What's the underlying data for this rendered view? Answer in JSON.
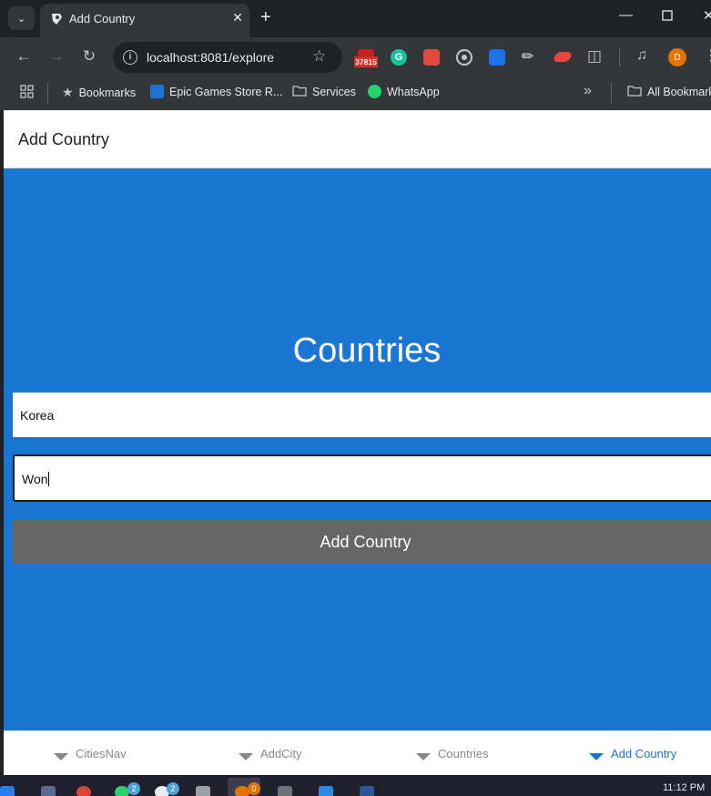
{
  "browser": {
    "tab": {
      "title": "Add Country"
    },
    "address_bar": {
      "url": "localhost:8081/explore"
    },
    "extension_badge": "37815",
    "profile_initial": "D",
    "bookmarks": {
      "bookmarks_label": "Bookmarks",
      "items": [
        "Epic Games Store R...",
        "Services",
        "WhatsApp"
      ],
      "overflow": "»",
      "all_bookmarks": "All Bookmarks"
    }
  },
  "app": {
    "title": "Add Country",
    "heading": "Countries",
    "form": {
      "country_name_value": "Korea",
      "currency_value": "Won",
      "submit_label": "Add Country"
    },
    "bottom_tabs": [
      {
        "label": "CitiesNav",
        "active": false
      },
      {
        "label": "AddCity",
        "active": false
      },
      {
        "label": "Countries",
        "active": false
      },
      {
        "label": "Add Country",
        "active": true
      }
    ]
  },
  "taskbar": {
    "badges": [
      "2",
      "2",
      "0"
    ],
    "clock": "11:12 PM"
  },
  "colors": {
    "page_background": "#1976d2",
    "submit_button": "#666666",
    "active_tab": "#1976d2"
  }
}
